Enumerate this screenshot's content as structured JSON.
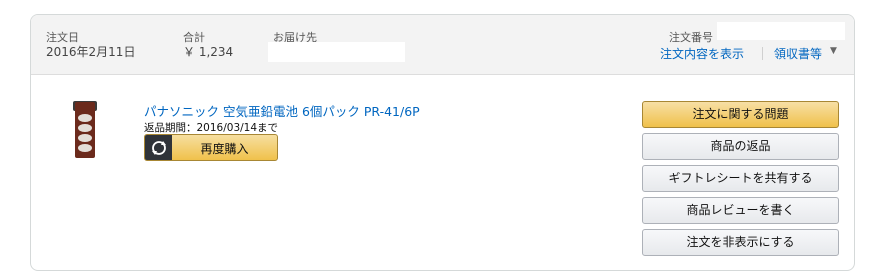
{
  "order": {
    "date_label": "注文日",
    "date_value": "2016年2月11日",
    "total_label": "合計",
    "total_value": "￥ 1,234",
    "ship_to_label": "お届け先",
    "order_number_label": "注文番号",
    "details_link": "注文内容を表示",
    "receipt_link": "領収書等"
  },
  "item": {
    "title": "パナソニック 空気亜鉛電池 6個パック PR-41/6P",
    "return_window": "返品期間：2016/03/14まで",
    "buy_again_label": "再度購入"
  },
  "actions": [
    {
      "label": "注文に関する問題",
      "primary": true
    },
    {
      "label": "商品の返品",
      "primary": false
    },
    {
      "label": "ギフトレシートを共有する",
      "primary": false
    },
    {
      "label": "商品レビューを書く",
      "primary": false
    },
    {
      "label": "注文を非表示にする",
      "primary": false
    }
  ],
  "icons": {
    "buy_again": "reorder-cycle-icon",
    "chevron": "chevron-down-icon"
  },
  "colors": {
    "link": "#0066c0",
    "primary_button": "#f0c14b",
    "header_bg": "#f3f3f3"
  }
}
